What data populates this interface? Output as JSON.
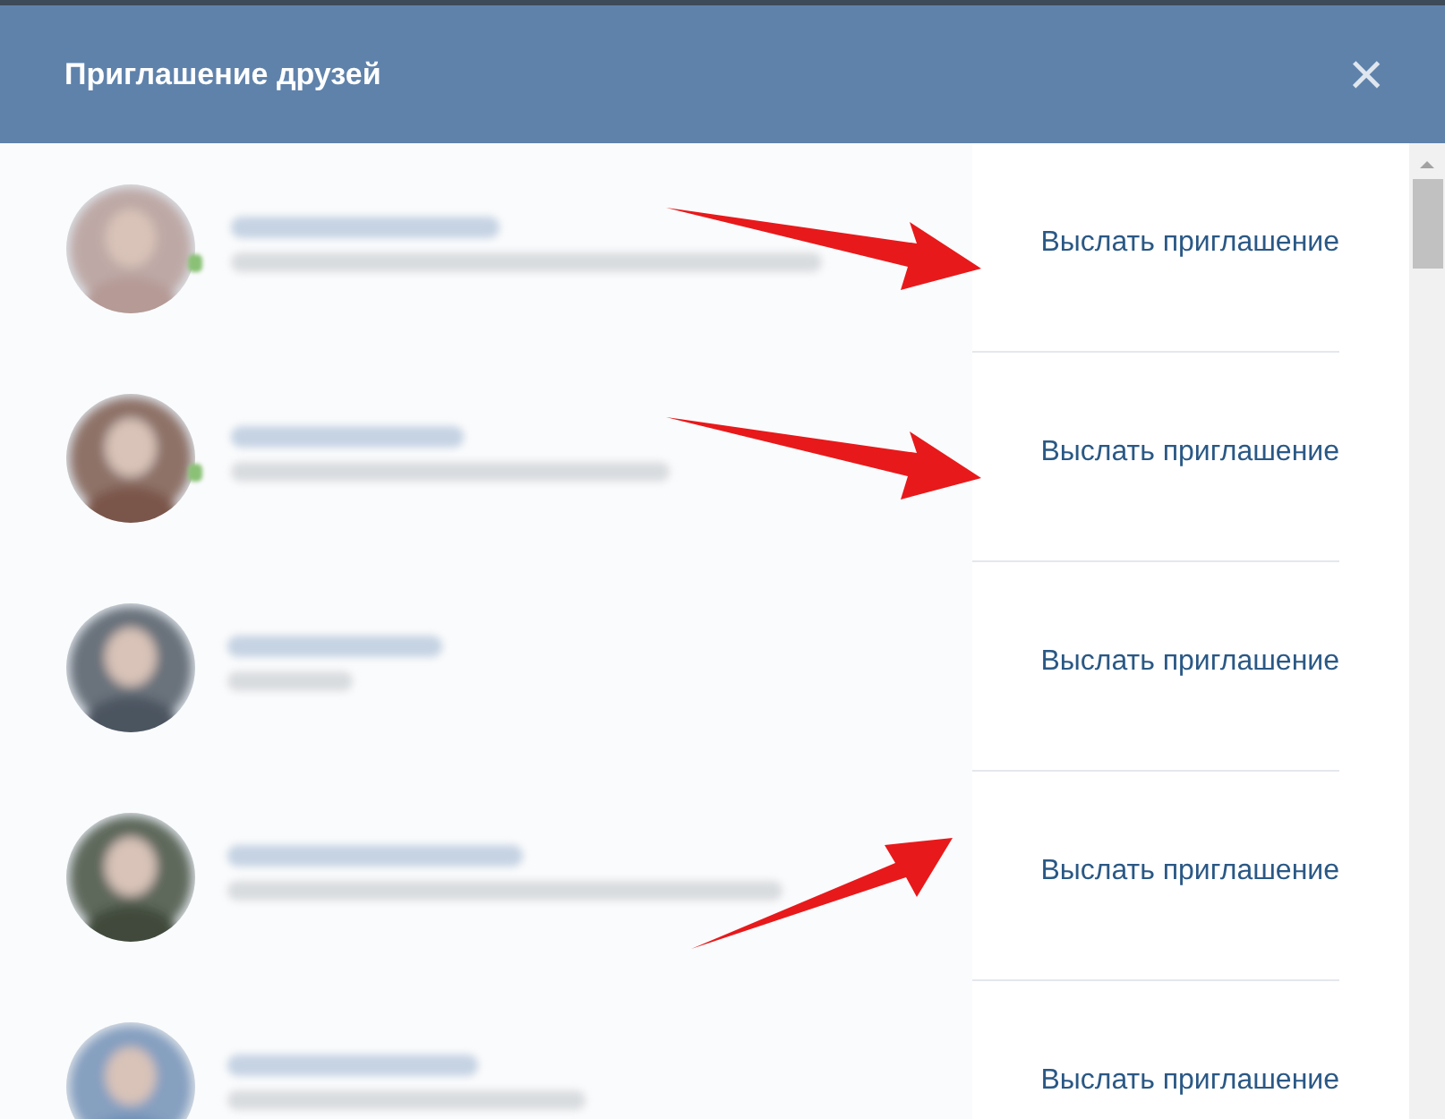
{
  "window": {
    "title": "Приглашение друзей",
    "close": "×"
  },
  "friends": [
    {
      "kind": "arrow-side",
      "online": true,
      "action": "Выслать приглашение"
    },
    {
      "kind": "arrow-side",
      "online": true,
      "action": "Выслать приглашение"
    },
    {
      "kind": "plain",
      "online": false,
      "action": "Выслать приглашение"
    },
    {
      "kind": "arrow-below",
      "online": false,
      "action": "Выслать приглашение"
    },
    {
      "kind": "plain",
      "online": false,
      "action": "Выслать приглашение"
    }
  ]
}
